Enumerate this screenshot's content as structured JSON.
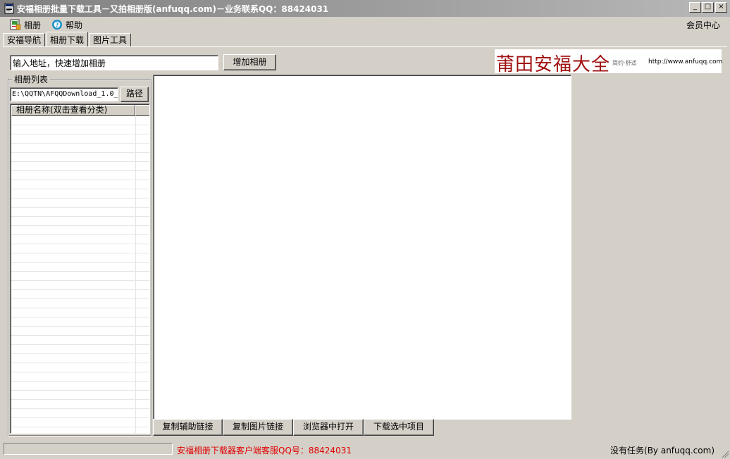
{
  "window": {
    "title": "安福相册批量下载工具－又拍相册版(anfuqq.com)－业务联系QQ：88424031",
    "min_glyph": "_",
    "max_glyph": "□",
    "close_glyph": "×"
  },
  "menu": {
    "album_label": "相册",
    "help_label": "帮助",
    "member_center_label": "会员中心"
  },
  "tabs": [
    {
      "label": "安福导航",
      "active": false
    },
    {
      "label": "相册下载",
      "active": true
    },
    {
      "label": "图片工具",
      "active": false
    }
  ],
  "toolbar": {
    "url_placeholder": "输入地址，快速增加相册",
    "add_album_label": "增加相册"
  },
  "banner": {
    "title": "莆田安福大全",
    "subtitle": "简约·舒适",
    "url": "http://www.anfuqq.com"
  },
  "album_list": {
    "group_label": "相册列表",
    "path_value": "E:\\QQTN\\AFQQDownload_1.0_",
    "path_button_label": "路径",
    "columns": [
      "相册名称(双击查看分类)",
      ""
    ]
  },
  "actions": {
    "copy_aux_link": "复制辅助链接",
    "copy_image_link": "复制图片链接",
    "open_in_browser": "浏览器中打开",
    "download_selected": "下载选中项目"
  },
  "status": {
    "qq_text": "安福相册下载器客户端客服QQ号：88424031",
    "task_text": "没有任务(By anfuqq.com)"
  },
  "colors": {
    "window_bg": "#d4d0c8",
    "banner_title": "#a01010",
    "status_qq": "#e00000"
  }
}
